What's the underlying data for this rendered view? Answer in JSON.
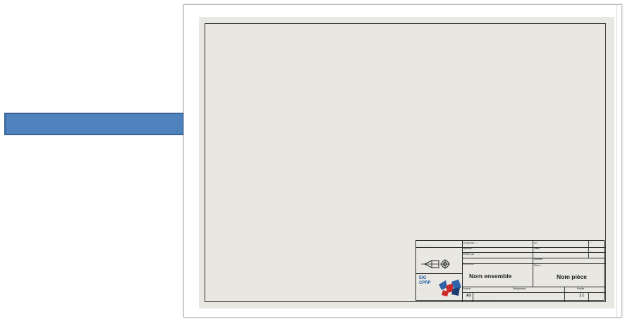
{
  "title_block": {
    "header_tiny": "··· ······ ·········· · ·",
    "fields": [
      {
        "label": "Conçu par :",
        "value": "..."
      },
      {
        "label": "Dessiné :",
        "value": "..."
      },
      {
        "label": "Vérifié par :",
        "value": "..."
      },
      {
        "label": "Ensemble :",
        "value": ""
      }
    ],
    "right_fields": [
      {
        "label": "Le :",
        "value": ""
      },
      {
        "label": "Date :",
        "value": ""
      },
      {
        "label": "Échelle :",
        "value": ""
      },
      {
        "label": "Pièce :",
        "value": ""
      }
    ],
    "assembly_name": "Nom ensemble",
    "part_name": "Nom pièce",
    "format_label": "Format",
    "format_value": "A3",
    "designation_label": "Désignation",
    "designation_value": "······· ········",
    "sheet_label": "Feuille",
    "sheet_value": "1 1",
    "logo_lines": [
      "EIG",
      "CPRP"
    ],
    "logo_small": "·· ····· ·\n···· · ··"
  },
  "colors": {
    "arrow_fill": "#4f81bd",
    "arrow_stroke": "#3a6496",
    "paper": "#e8e7e1",
    "logo_blue": "#2f62a8",
    "logo_red": "#cc2a2a"
  }
}
